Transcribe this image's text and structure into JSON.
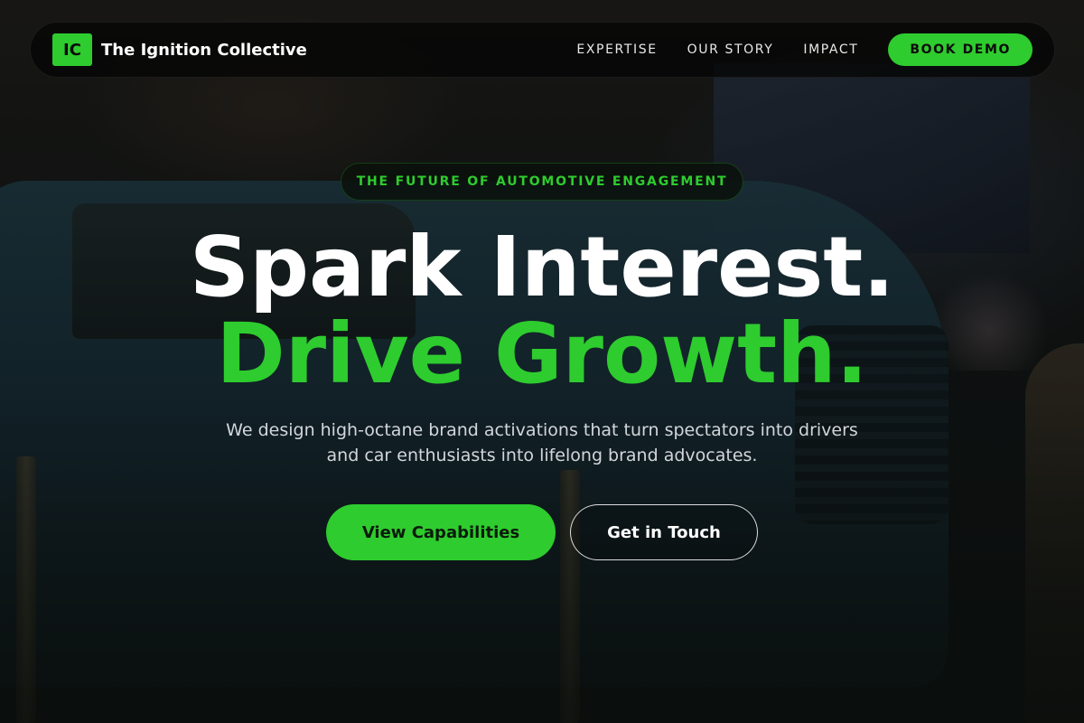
{
  "brand": {
    "logo_initials": "IC",
    "name": "The Ignition Collective"
  },
  "nav": {
    "links": [
      "EXPERTISE",
      "OUR STORY",
      "IMPACT"
    ],
    "cta_label": "BOOK DEMO"
  },
  "hero": {
    "eyebrow": "THE FUTURE OF AUTOMOTIVE ENGAGEMENT",
    "headline_line1": "Spark Interest.",
    "headline_line2": "Drive Growth.",
    "subtitle": "We design high-octane brand activations that turn spectators into drivers and car enthusiasts into lifelong brand advocates.",
    "primary_cta": "View Capabilities",
    "secondary_cta": "Get in Touch"
  },
  "colors": {
    "accent": "#2ecc2e",
    "nav_background": "#060606",
    "text": "#ffffff"
  }
}
